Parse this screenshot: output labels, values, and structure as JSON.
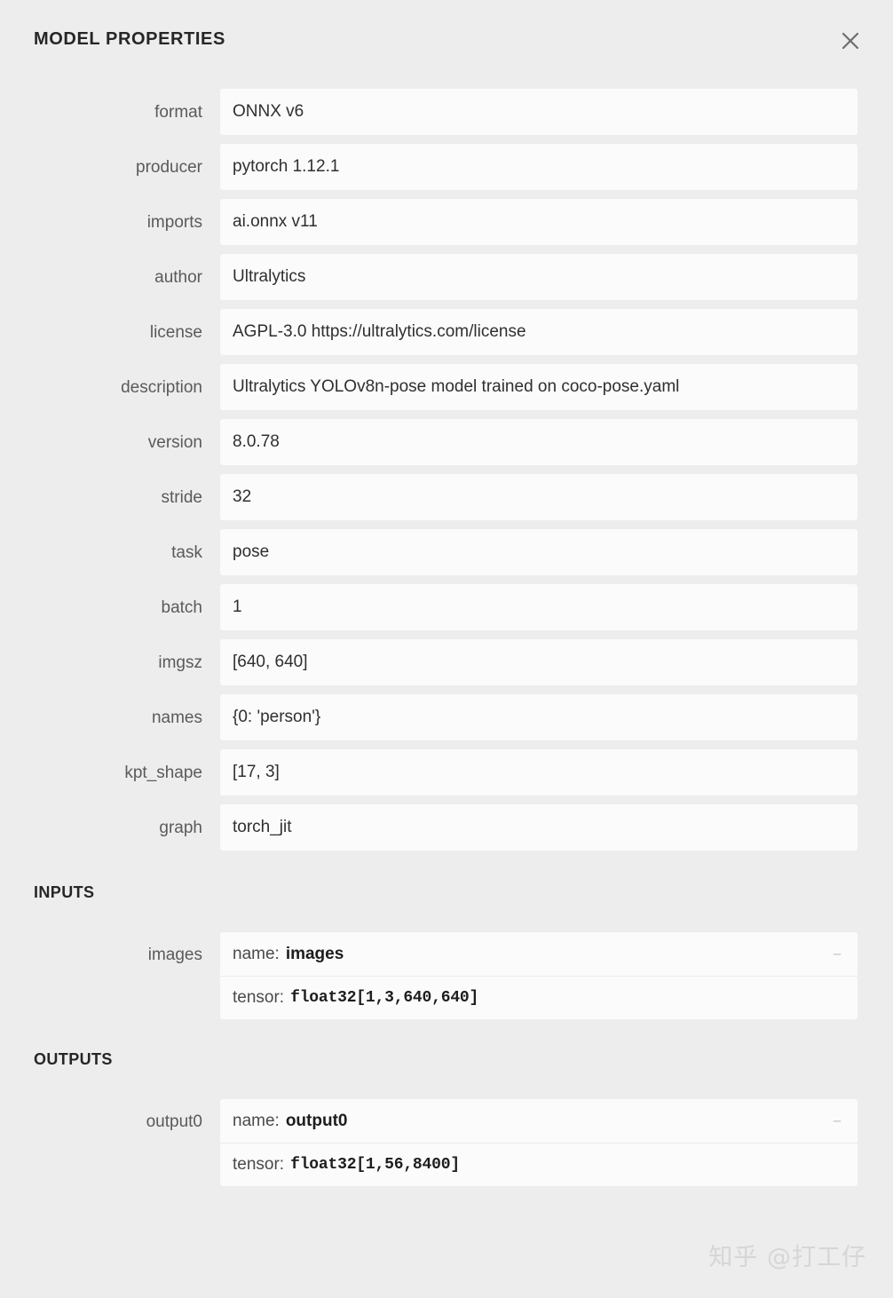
{
  "header": {
    "title": "MODEL PROPERTIES",
    "close_icon": "close-icon",
    "close_label": "✕"
  },
  "properties": [
    {
      "label": "format",
      "value": "ONNX v6"
    },
    {
      "label": "producer",
      "value": "pytorch 1.12.1"
    },
    {
      "label": "imports",
      "value": "ai.onnx v11"
    },
    {
      "label": "author",
      "value": "Ultralytics"
    },
    {
      "label": "license",
      "value": "AGPL-3.0 https://ultralytics.com/license"
    },
    {
      "label": "description",
      "value": "Ultralytics YOLOv8n-pose model trained on coco-pose.yaml"
    },
    {
      "label": "version",
      "value": "8.0.78"
    },
    {
      "label": "stride",
      "value": "32"
    },
    {
      "label": "task",
      "value": "pose"
    },
    {
      "label": "batch",
      "value": "1"
    },
    {
      "label": "imgsz",
      "value": "[640, 640]"
    },
    {
      "label": "names",
      "value": "{0: 'person'}"
    },
    {
      "label": "kpt_shape",
      "value": "[17, 3]"
    },
    {
      "label": "graph",
      "value": "torch_jit"
    }
  ],
  "inputs": {
    "heading": "INPUTS",
    "items": [
      {
        "label": "images",
        "name_key": "name:",
        "name_value": "images",
        "tensor_key": "tensor:",
        "tensor_value": "float32[1,3,640,640]",
        "collapse_label": "−"
      }
    ]
  },
  "outputs": {
    "heading": "OUTPUTS",
    "items": [
      {
        "label": "output0",
        "name_key": "name:",
        "name_value": "output0",
        "tensor_key": "tensor:",
        "tensor_value": "float32[1,56,8400]",
        "collapse_label": "−"
      }
    ]
  },
  "watermark": {
    "text": "知乎 @打工仔"
  },
  "colors": {
    "background": "#ededed",
    "card": "#fbfbfb",
    "label_text": "#5a5a5a",
    "value_text": "#2f2f2f",
    "heading_text": "#262626",
    "watermark": "#d6d6d6"
  }
}
